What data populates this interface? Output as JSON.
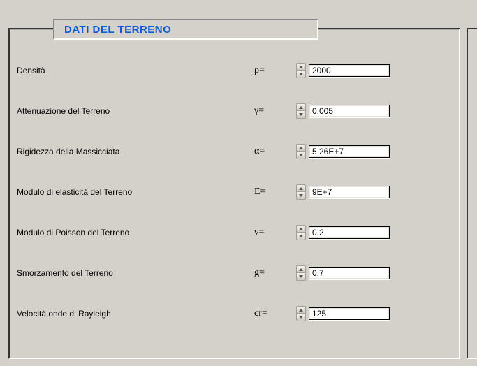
{
  "title": "DATI DEL TERRENO",
  "rows": [
    {
      "label": "Densità",
      "symbol": "ρ=",
      "value": "2000"
    },
    {
      "label": "Attenuazione del Terreno",
      "symbol": "γ=",
      "value": "0,005"
    },
    {
      "label": "Rigidezza della Massicciata",
      "symbol": "α=",
      "value": "5,26E+7"
    },
    {
      "label": "Modulo di elasticità del Terreno",
      "symbol": "E=",
      "value": "9E+7"
    },
    {
      "label": "Modulo di Poisson del Terreno",
      "symbol": "ν=",
      "value": "0,2"
    },
    {
      "label": "Smorzamento del Terreno",
      "symbol": "g=",
      "value": "0,7"
    },
    {
      "label": "Velocità onde di Rayleigh",
      "symbol": "cr=",
      "value": "125"
    }
  ]
}
